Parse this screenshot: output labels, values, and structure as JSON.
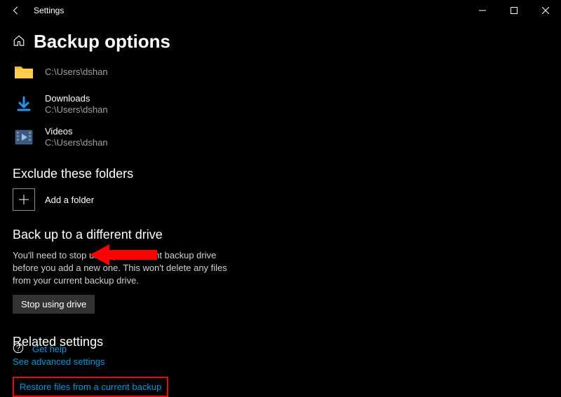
{
  "app_title": "Settings",
  "page_title": "Backup options",
  "folders": [
    {
      "name": "",
      "path": "C:\\Users\\dshan"
    },
    {
      "name": "Downloads",
      "path": "C:\\Users\\dshan"
    },
    {
      "name": "Videos",
      "path": "C:\\Users\\dshan"
    }
  ],
  "exclude": {
    "heading": "Exclude these folders",
    "add_label": "Add a folder"
  },
  "diffdrive": {
    "heading": "Back up to a different drive",
    "desc": "You'll need to stop using your current backup drive before you add a new one. This won't delete any files from your current backup drive.",
    "button": "Stop using drive"
  },
  "related": {
    "heading": "Related settings",
    "advanced": "See advanced settings",
    "restore": "Restore files from a current backup"
  },
  "help": {
    "label": "Get help"
  }
}
